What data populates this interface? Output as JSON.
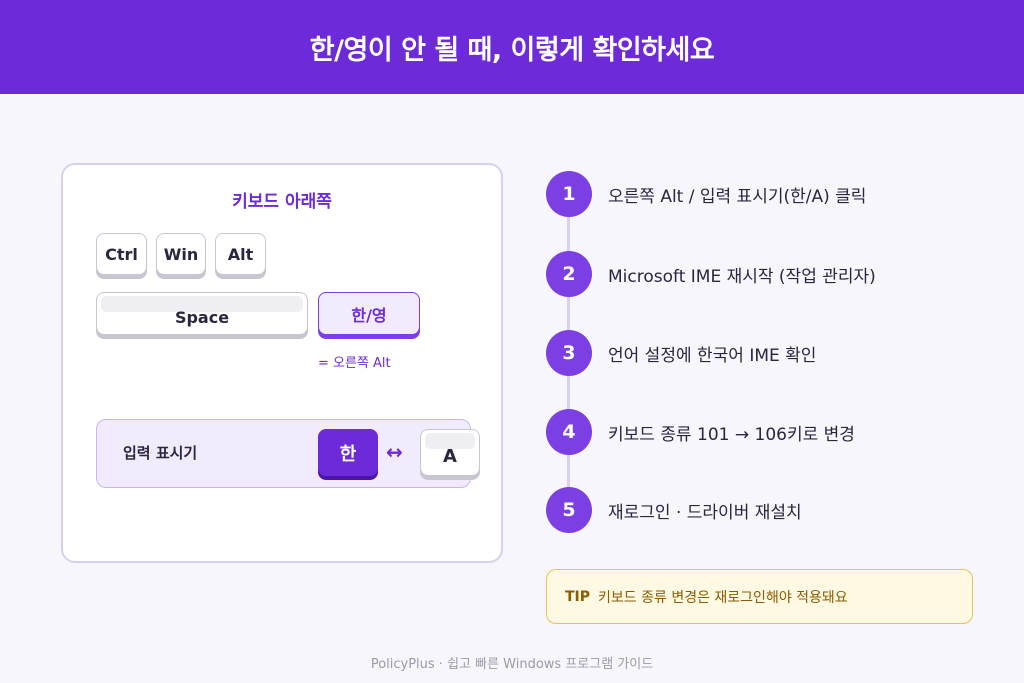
{
  "header": {
    "title": "한/영이 안 될 때, 이렇게 확인하세요"
  },
  "keyboard": {
    "title": "키보드 아래쪽",
    "keys": {
      "ctrl": "Ctrl",
      "win": "Win",
      "alt": "Alt",
      "space": "Space",
      "hanyoung": "한/영"
    },
    "hanyoung_note": "= 오른쪽 Alt"
  },
  "indicator": {
    "label": "입력 표시기",
    "han": "한",
    "arrow": "↔",
    "a": "A"
  },
  "steps": [
    {
      "num": "1",
      "text": "오른쪽 Alt / 입력 표시기(한/A) 클릭"
    },
    {
      "num": "2",
      "text": "Microsoft IME 재시작 (작업 관리자)"
    },
    {
      "num": "3",
      "text": "언어 설정에 한국어 IME 확인"
    },
    {
      "num": "4",
      "text": "키보드 종류 101 → 106키로 변경"
    },
    {
      "num": "5",
      "text": "재로그인 · 드라이버 재설치"
    }
  ],
  "tip": {
    "label": "TIP",
    "text": "키보드 종류 변경은 재로그인해야 적용돼요"
  },
  "footer": {
    "text": "PolicyPlus · 쉽고 빠른 Windows 프로그램 가이드"
  },
  "colors": {
    "brand": "#6d2ad8",
    "tip_bg": "#fff8e2",
    "tip_text": "#8a5d00"
  }
}
